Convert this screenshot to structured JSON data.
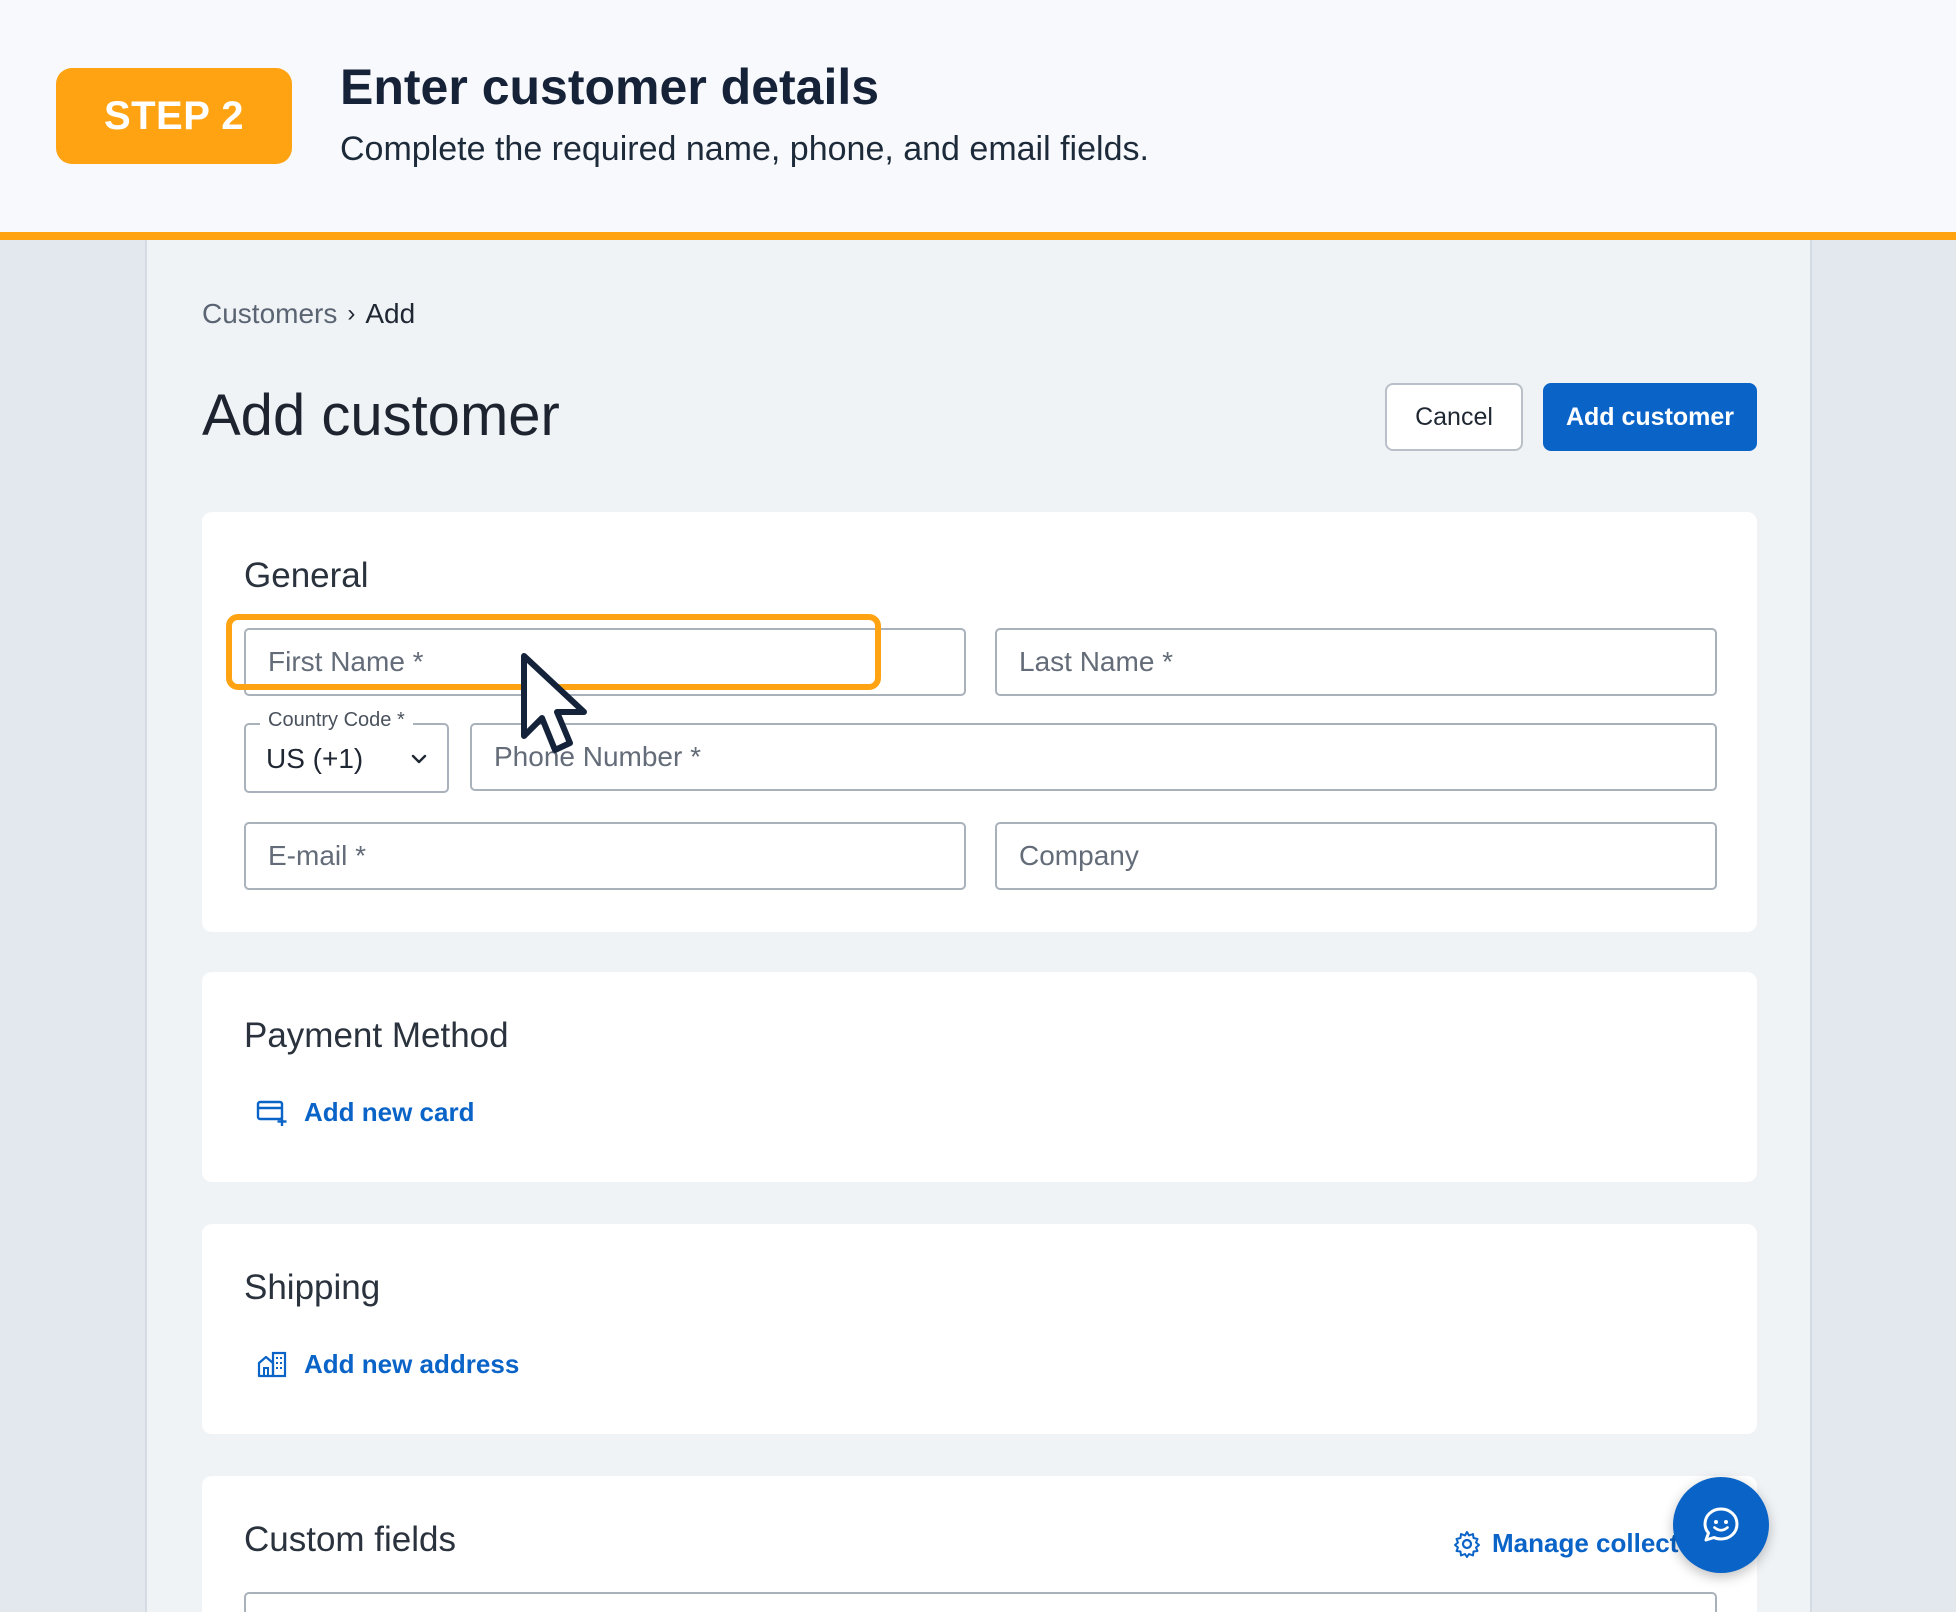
{
  "banner": {
    "step_label": "STEP 2",
    "title": "Enter customer details",
    "subtitle": "Complete the required name, phone, and email fields."
  },
  "breadcrumb": {
    "parent": "Customers",
    "separator": "›",
    "current": "Add"
  },
  "header": {
    "title": "Add customer",
    "cancel_label": "Cancel",
    "add_label": "Add customer"
  },
  "general": {
    "title": "General",
    "first_name_placeholder": "First Name *",
    "last_name_placeholder": "Last Name *",
    "country_code_label": "Country Code *",
    "country_code_value": "US (+1)",
    "phone_placeholder": "Phone Number *",
    "email_placeholder": "E-mail *",
    "company_placeholder": "Company"
  },
  "payment": {
    "title": "Payment Method",
    "add_card_label": "Add new card",
    "icon": "credit-card-add-icon"
  },
  "shipping": {
    "title": "Shipping",
    "add_address_label": "Add new address",
    "icon": "building-address-icon"
  },
  "custom_fields": {
    "title": "Custom fields",
    "manage_label": "Manage collected d",
    "icon": "gear-icon"
  },
  "colors": {
    "accent_orange": "#ffa312",
    "primary_blue": "#0a64c8",
    "banner_text": "#152238"
  }
}
